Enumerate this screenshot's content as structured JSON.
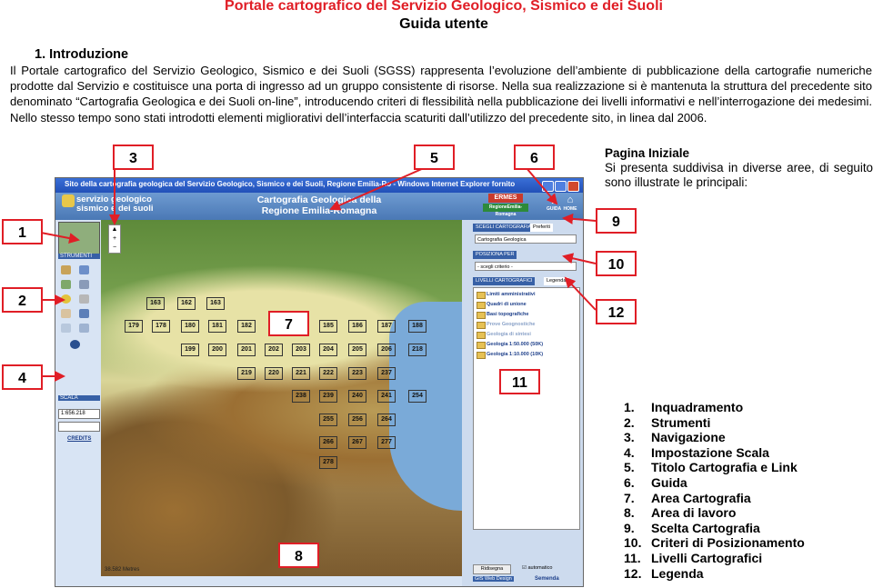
{
  "header": {
    "title": "Portale cartografico del Servizio Geologico, Sismico e dei Suoli",
    "subtitle": "Guida utente"
  },
  "section": {
    "heading": "1. Introduzione",
    "paragraph": "Il Portale cartografico del Servizio Geologico, Sismico e dei Suoli (SGSS) rappresenta l’evoluzione dell’ambiente di pubblicazione della cartografie numeriche prodotte dal Servizio e costituisce una porta di ingresso ad un gruppo consistente di risorse. Nella sua realizzazione si è mantenuta la struttura del precedente sito denominato “Cartografia Geologica e dei Suoli on-line”, introducendo criteri di flessibilità nella pubblicazione dei livelli informativi e nell’interrogazione dei medesimi. Nello stesso tempo sono stati introdotti elementi migliorativi dell’interfaccia scaturiti dall’utilizzo del precedente sito, in linea dal 2006."
  },
  "screenshot": {
    "window_title": "Sito della cartografia geologica del Servizio Geologico, Sismico e dei Suoli, Regione Emilia-Ro - Windows Internet Explorer fornito",
    "logo_text": "servizio geologico\nsismico e dei suoli",
    "map_title": "Cartografia Geologica della\nRegione Emilia-Romagna",
    "ermes_label": "ERMES",
    "ermes_sub": "RegioneEmilia-Romagna",
    "guida_label": "GUIDA",
    "home_label": "HOME",
    "strumenti_label": "STRUMENTI",
    "scala_label": "SCALA",
    "scale_value": "1:656.218",
    "credits_label": "CREDITS",
    "scale_bar_label": "38.582 Metres",
    "scegli_tab": "SCEGLI CARTOGRAFIA",
    "preferiti_tab": "Preferiti",
    "cartography_select": "Cartografia Geologica",
    "posizione_tab": "POSIZIONA PER",
    "criterio_select": "- scegli criterio -",
    "livelli_tab": "LIVELLI CARTOGRAFICI",
    "legenda_tab": "Legenda",
    "layers": [
      "Limiti amministrativi",
      "Quadri di unione",
      "Basi topografiche",
      "Prove Geognostiche",
      "Geologia di sintesi",
      "Geologia 1:50.000 (50K)",
      "Geologia 1:10.000 (10K)"
    ],
    "ridisegna_button": "Ridisegna",
    "auto_label": "automatico",
    "gis_label": "GIS Web Design",
    "semenda_label": "Semenda",
    "grid_cells": [
      "163",
      "162",
      "163",
      "179",
      "178",
      "180",
      "181",
      "182",
      "185",
      "186",
      "187",
      "188",
      "199",
      "200",
      "201",
      "202",
      "203",
      "204",
      "205",
      "206",
      "218",
      "219",
      "220",
      "221",
      "222",
      "223",
      "237",
      "238",
      "239",
      "240",
      "241",
      "254",
      "255",
      "256",
      "264",
      "266",
      "267",
      "277",
      "278"
    ]
  },
  "callouts": [
    "1",
    "2",
    "3",
    "4",
    "5",
    "6",
    "7",
    "8",
    "9",
    "10",
    "11",
    "12"
  ],
  "side": {
    "heading": "Pagina Iniziale",
    "description": "Si presenta suddivisa in diverse aree, di seguito sono illustrate le principali:"
  },
  "legend_list": [
    {
      "n": "1.",
      "label": "Inquadramento"
    },
    {
      "n": "2.",
      "label": "Strumenti"
    },
    {
      "n": "3.",
      "label": "Navigazione"
    },
    {
      "n": "4.",
      "label": "Impostazione Scala"
    },
    {
      "n": "5.",
      "label": "Titolo Cartografia e Link"
    },
    {
      "n": "6.",
      "label": "Guida"
    },
    {
      "n": "7.",
      "label": "Area Cartografia"
    },
    {
      "n": "8.",
      "label": "Area di lavoro"
    },
    {
      "n": "9.",
      "label": "Scelta Cartografia"
    },
    {
      "n": "10.",
      "label": "Criteri di Posizionamento"
    },
    {
      "n": "11.",
      "label": "Livelli Cartografici"
    },
    {
      "n": "12.",
      "label": "Legenda"
    }
  ],
  "colors": {
    "title_red": "#e01e26",
    "callout_border": "#e01e26",
    "ui_blue": "#3760a6"
  }
}
